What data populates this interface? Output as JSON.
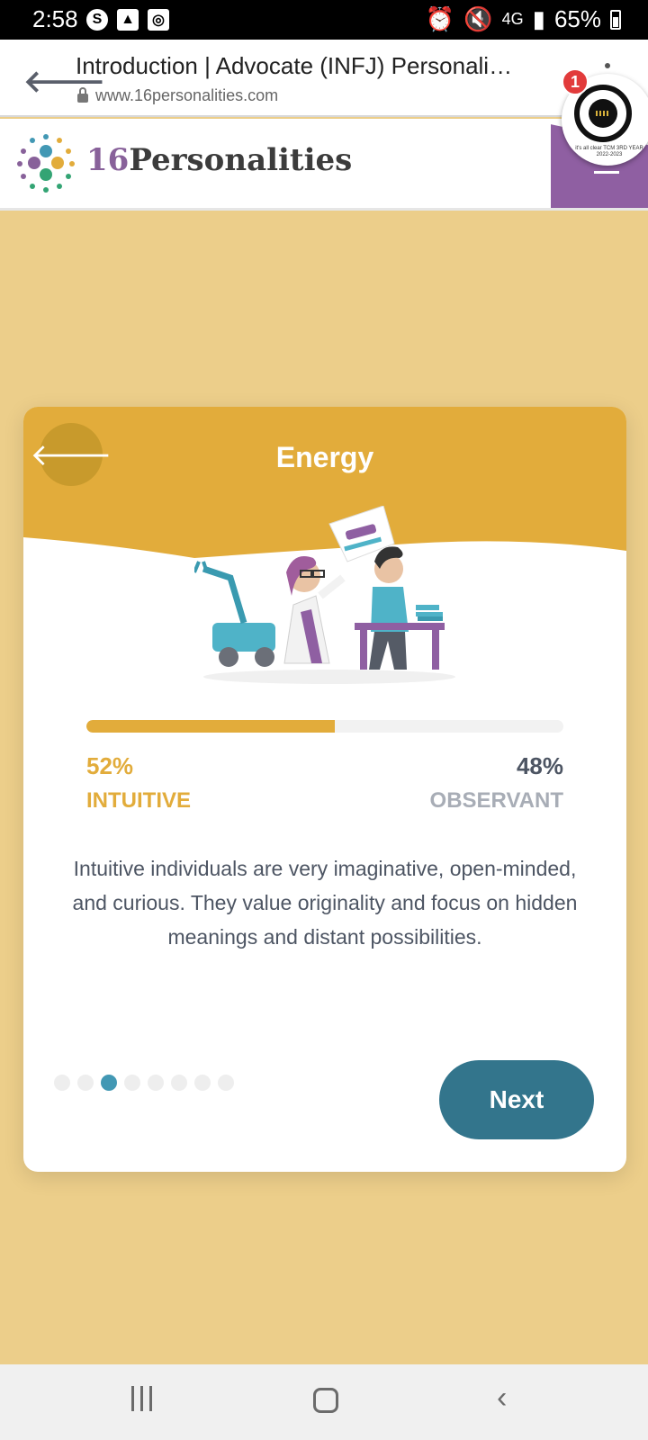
{
  "status_bar": {
    "time": "2:58",
    "battery": "65%",
    "network": "4G"
  },
  "browser": {
    "page_title": "Introduction | Advocate (INFJ) Personali…",
    "url": "www.16personalities.com",
    "notification_count": "1",
    "bubble_caption": "it's all clear TCM 3RD YEAR 2022-2023"
  },
  "site": {
    "logo_number": "16",
    "logo_word": "Personalities"
  },
  "card": {
    "title": "Energy",
    "progress_percent": 52,
    "left_percent": "52%",
    "left_trait": "INTUITIVE",
    "right_percent": "48%",
    "right_trait": "OBSERVANT",
    "description": "Intuitive individuals are very imaginative, open-minded, and curious. They value originality and focus on hidden meanings and distant possibilities.",
    "pagination": {
      "total": 8,
      "current": 3
    },
    "next_label": "Next"
  },
  "colors": {
    "background": "#ecce8a",
    "accent_gold": "#e2ac3b",
    "button_teal": "#33758c",
    "active_dot": "#4298b4"
  }
}
